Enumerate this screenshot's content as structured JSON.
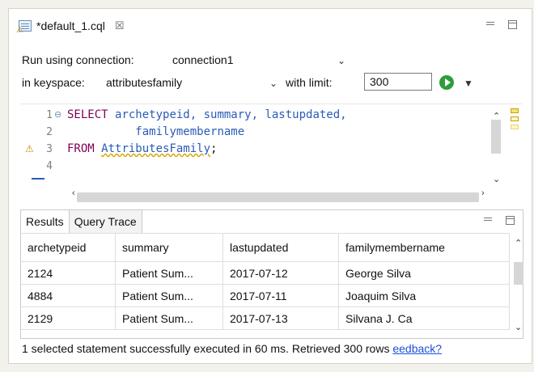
{
  "tab": {
    "title": "*default_1.cql",
    "close": "☒"
  },
  "form": {
    "run_label": "Run using connection:",
    "connection_value": "connection1",
    "keyspace_label": "in keyspace:",
    "keyspace_value": "attributesfamily",
    "limit_label": "with limit:",
    "limit_value": "300"
  },
  "editor": {
    "line_numbers": [
      "1",
      "2",
      "3",
      "4"
    ],
    "lines": [
      [
        "SELECT ",
        "archetypeid, summary, lastupdated,"
      ],
      [
        "",
        "familymembername"
      ],
      [
        "FROM ",
        "AttributesFamily",
        ";"
      ],
      [
        ""
      ]
    ]
  },
  "results": {
    "tabs": [
      "Results",
      "Query Trace"
    ],
    "columns": [
      "archetypeid",
      "summary",
      "lastupdated",
      "familymembername"
    ],
    "rows": [
      [
        "2124",
        "Patient Sum...",
        "2017-07-12",
        "George Silva"
      ],
      [
        "4884",
        "Patient Sum...",
        "2017-07-11",
        "Joaquim Silva"
      ],
      [
        "2129",
        "Patient Sum...",
        "2017-07-13",
        "Silvana J. Ca"
      ]
    ]
  },
  "status": {
    "message": "1 selected statement successfully executed in 60 ms. Retrieved 300 rows ",
    "link": "eedback?"
  },
  "colors": {
    "keyword": "#7f0055",
    "identifier": "#2a5bb8",
    "run": "#2f9d3a",
    "link": "#1a4fd6"
  }
}
